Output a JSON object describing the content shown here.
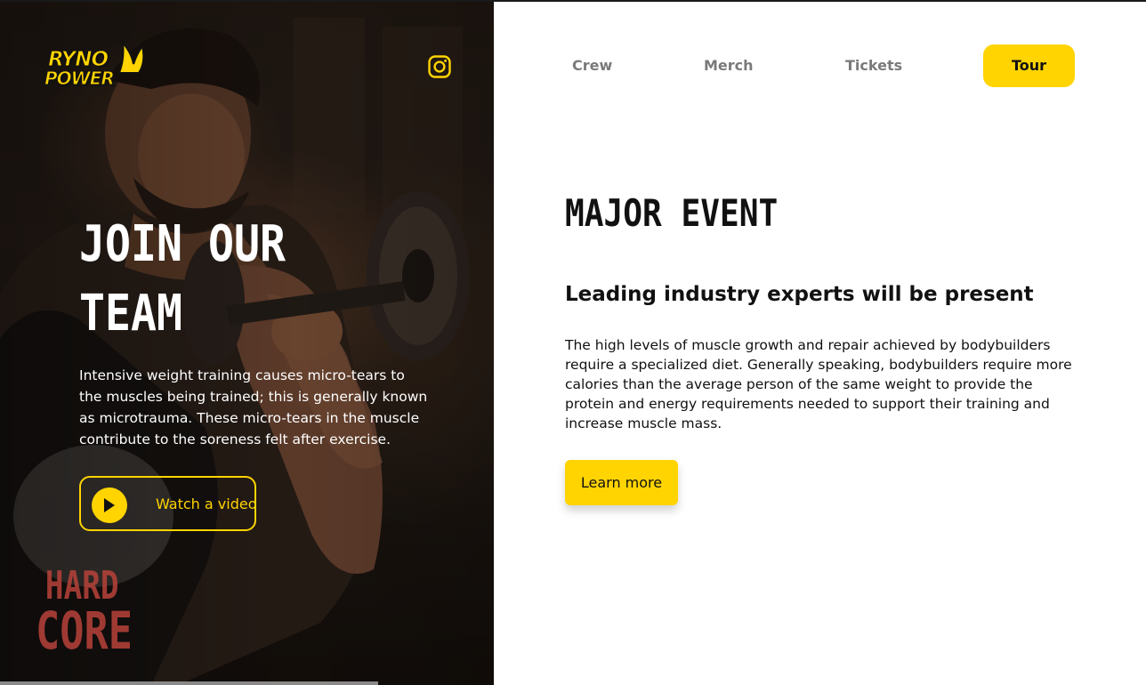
{
  "brand": {
    "logo_line1": "RYNO",
    "logo_line2": "POWER",
    "accent_color": "#ffd400"
  },
  "hero": {
    "title_line1": "JOIN OUR",
    "title_line2": "TEAM",
    "text": "Intensive weight training causes micro-tears to the muscles being trained; this is generally known as microtrauma. These micro-tears in the muscle contribute to the soreness felt after exercise.",
    "watch_label": "Watch a video",
    "shirt_line1": "HARD",
    "shirt_line2": "CORE",
    "social_icon": "instagram-icon",
    "play_icon": "play-icon"
  },
  "nav": {
    "items": [
      {
        "label": "Crew"
      },
      {
        "label": "Merch"
      },
      {
        "label": "Tickets"
      },
      {
        "label": "Tour"
      }
    ]
  },
  "main": {
    "title": "MAJOR EVENT",
    "subtitle": "Leading industry experts will be present",
    "body": "The high levels of muscle growth and repair achieved by bodybuilders require a specialized diet. Generally speaking, bodybuilders require more calories than the average person of the same weight to provide the protein and energy requirements needed to support their training and increase muscle mass.",
    "cta_label": "Learn more"
  }
}
